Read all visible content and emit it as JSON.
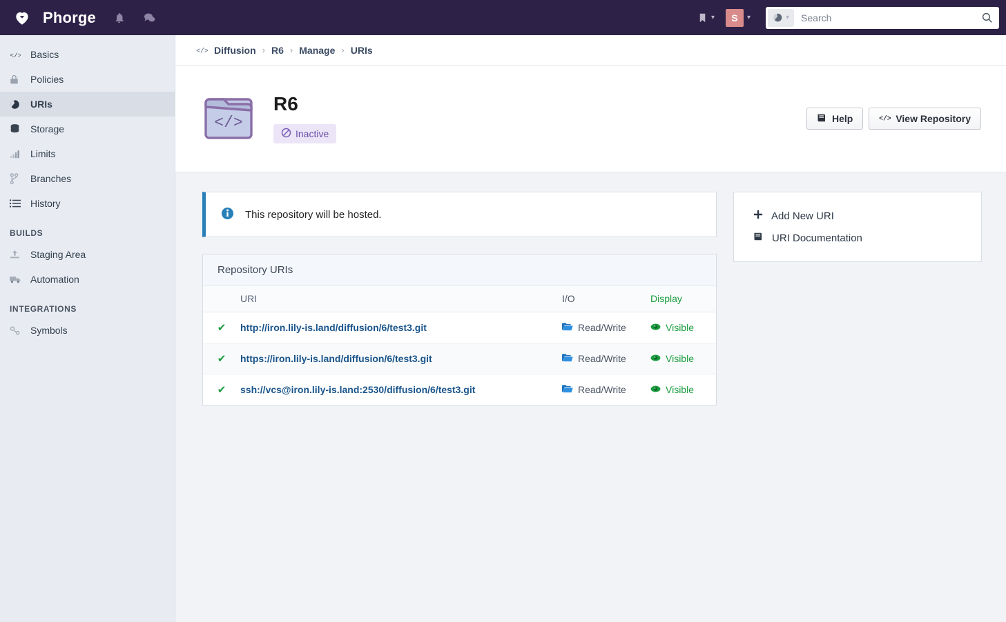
{
  "header": {
    "brand": "Phorge",
    "logo_icon": "heart-icon",
    "bell_icon": "bell-notification-icon",
    "chat_icon": "chat-bubble-icon",
    "bookmark_icon": "bookmark-icon",
    "avatar_initial": "S",
    "avatar_color": "#d98b8b",
    "background_color": "#2d2147",
    "search": {
      "placeholder": "Search",
      "value": "",
      "scope_icon": "globe-icon",
      "submit_icon": "search-icon"
    }
  },
  "sidebar": {
    "items": [
      {
        "label": "Basics",
        "icon": "code-tags-icon",
        "active": false
      },
      {
        "label": "Policies",
        "icon": "lock-icon",
        "active": false
      },
      {
        "label": "URIs",
        "icon": "globe-icon",
        "active": true
      },
      {
        "label": "Storage",
        "icon": "database-icon",
        "active": false
      },
      {
        "label": "Limits",
        "icon": "bar-chart-icon",
        "active": false
      },
      {
        "label": "Branches",
        "icon": "branch-icon",
        "active": false
      },
      {
        "label": "History",
        "icon": "list-icon",
        "active": false
      }
    ],
    "sections": [
      {
        "title": "BUILDS",
        "items": [
          {
            "label": "Staging Area",
            "icon": "upload-icon"
          },
          {
            "label": "Automation",
            "icon": "truck-icon"
          }
        ]
      },
      {
        "title": "INTEGRATIONS",
        "items": [
          {
            "label": "Symbols",
            "icon": "link-chain-icon"
          }
        ]
      }
    ]
  },
  "breadcrumb": {
    "icon": "code-tags-icon",
    "separator": "›",
    "items": [
      "Diffusion",
      "R6",
      "Manage",
      "URIs"
    ]
  },
  "page_header": {
    "repo_icon": "repository-folder-code-icon",
    "title": "R6",
    "status_badge": {
      "label": "Inactive",
      "icon": "no-entry-icon",
      "background": "#ebe5f7",
      "text_color": "#6b4fa8"
    },
    "actions": [
      {
        "label": "Help",
        "icon": "book-icon"
      },
      {
        "label": "View Repository",
        "icon": "code-tags-icon"
      }
    ]
  },
  "notice": {
    "icon": "info-circle-icon",
    "text": "This repository will be hosted.",
    "accent_color": "#2980b9"
  },
  "uri_table": {
    "title": "Repository URIs",
    "columns": [
      "",
      "URI",
      "I/O",
      "Display"
    ],
    "rows": [
      {
        "enabled_icon": "check-icon",
        "uri": "http://iron.lily-is.land/diffusion/6/test3.git",
        "io_icon": "open-folder-icon",
        "io": "Read/Write",
        "display_icon": "eye-icon",
        "display": "Visible"
      },
      {
        "enabled_icon": "check-icon",
        "uri": "https://iron.lily-is.land/diffusion/6/test3.git",
        "io_icon": "open-folder-icon",
        "io": "Read/Write",
        "display_icon": "eye-icon",
        "display": "Visible"
      },
      {
        "enabled_icon": "check-icon",
        "uri": "ssh://vcs@iron.lily-is.land:2530/diffusion/6/test3.git",
        "io_icon": "open-folder-icon",
        "io": "Read/Write",
        "display_icon": "eye-icon",
        "display": "Visible"
      }
    ]
  },
  "action_panel": {
    "items": [
      {
        "label": "Add New URI",
        "icon": "plus-icon"
      },
      {
        "label": "URI Documentation",
        "icon": "book-icon"
      }
    ]
  }
}
